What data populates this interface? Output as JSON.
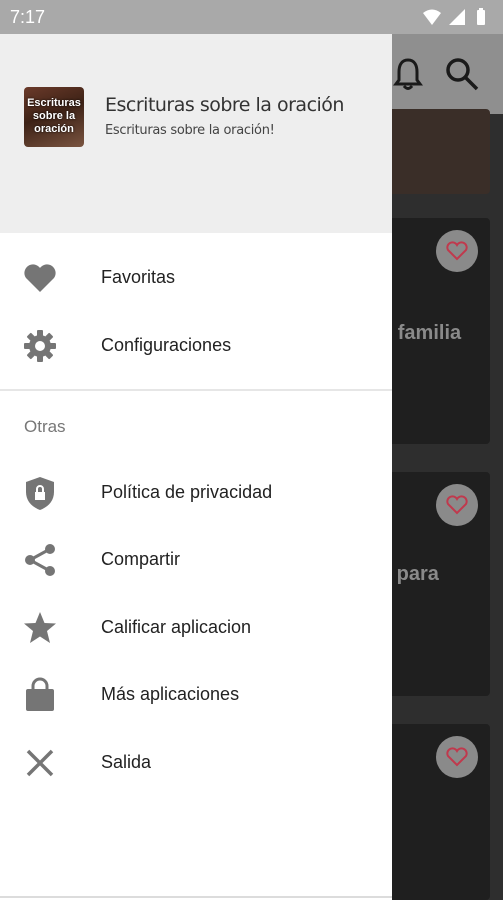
{
  "status_bar": {
    "time": "7:17"
  },
  "drawer": {
    "header": {
      "logo_text": "Escrituras sobre la oración",
      "app_title": "Escrituras sobre la oración",
      "app_subtitle": "Escrituras sobre la oración!"
    },
    "primary_items": [
      {
        "label": "Favoritas",
        "icon": "heart-icon"
      },
      {
        "label": "Configuraciones",
        "icon": "gear-icon"
      }
    ],
    "section_label": "Otras",
    "secondary_items": [
      {
        "label": "Política de privacidad",
        "icon": "shield-lock-icon"
      },
      {
        "label": "Compartir",
        "icon": "share-icon"
      },
      {
        "label": "Calificar aplicacion",
        "icon": "star-icon"
      },
      {
        "label": "Más aplicaciones",
        "icon": "shopping-bag-icon"
      },
      {
        "label": "Salida",
        "icon": "close-icon"
      }
    ]
  },
  "background": {
    "cards": [
      {
        "title": "u familia"
      },
      {
        "title": "s para"
      },
      {
        "title": ""
      }
    ]
  },
  "colors": {
    "icon": "#757575",
    "header_bg": "#eeeeee",
    "status_bar": "#a9a9a9"
  }
}
